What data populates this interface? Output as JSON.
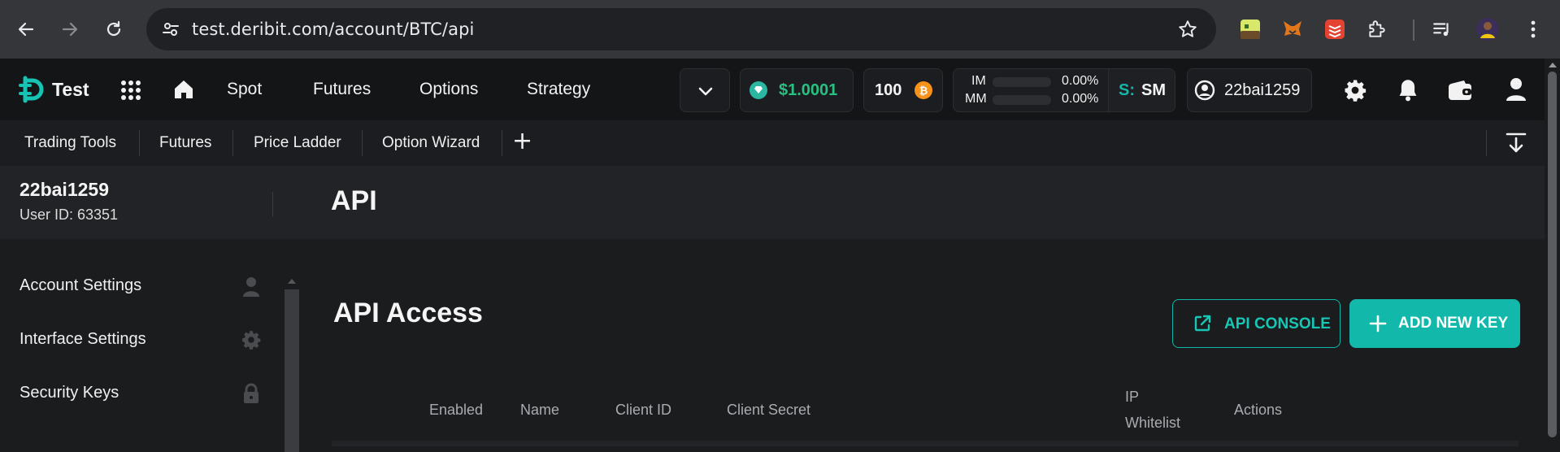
{
  "browser": {
    "url": "test.deribit.com/account/BTC/api"
  },
  "header": {
    "logo_text": "Test",
    "nav": [
      "Spot",
      "Futures",
      "Options",
      "Strategy"
    ],
    "balance": "$1.0001",
    "btc_amount": "100",
    "im_label": "IM",
    "mm_label": "MM",
    "im_value": "0.00%",
    "mm_value": "0.00%",
    "im_fraction": 0,
    "mm_fraction": 0,
    "mode_prefix": "S:",
    "mode_value": "SM",
    "username": "22bai1259",
    "colors": {
      "accent": "#12b8a9",
      "balance_green": "#27c281",
      "btc_orange": "#f7931a"
    }
  },
  "toolbar": {
    "items": [
      "Trading Tools",
      "Futures",
      "Price Ladder",
      "Option Wizard"
    ],
    "add_label": "+"
  },
  "user": {
    "name": "22bai1259",
    "user_id": "User ID: 63351"
  },
  "page": {
    "title": "API"
  },
  "sidebar": {
    "items": [
      {
        "label": "Account Settings",
        "icon": "user-icon"
      },
      {
        "label": "Interface Settings",
        "icon": "gear-icon"
      },
      {
        "label": "Security Keys",
        "icon": "lock-icon"
      }
    ]
  },
  "api": {
    "heading": "API Access",
    "console_label": "API CONSOLE",
    "add_key_label": "ADD NEW KEY",
    "columns": {
      "enabled": "Enabled",
      "name": "Name",
      "client_id": "Client ID",
      "client_secret": "Client Secret",
      "ip_line1": "IP",
      "ip_line2": "Whitelist",
      "actions": "Actions"
    }
  }
}
